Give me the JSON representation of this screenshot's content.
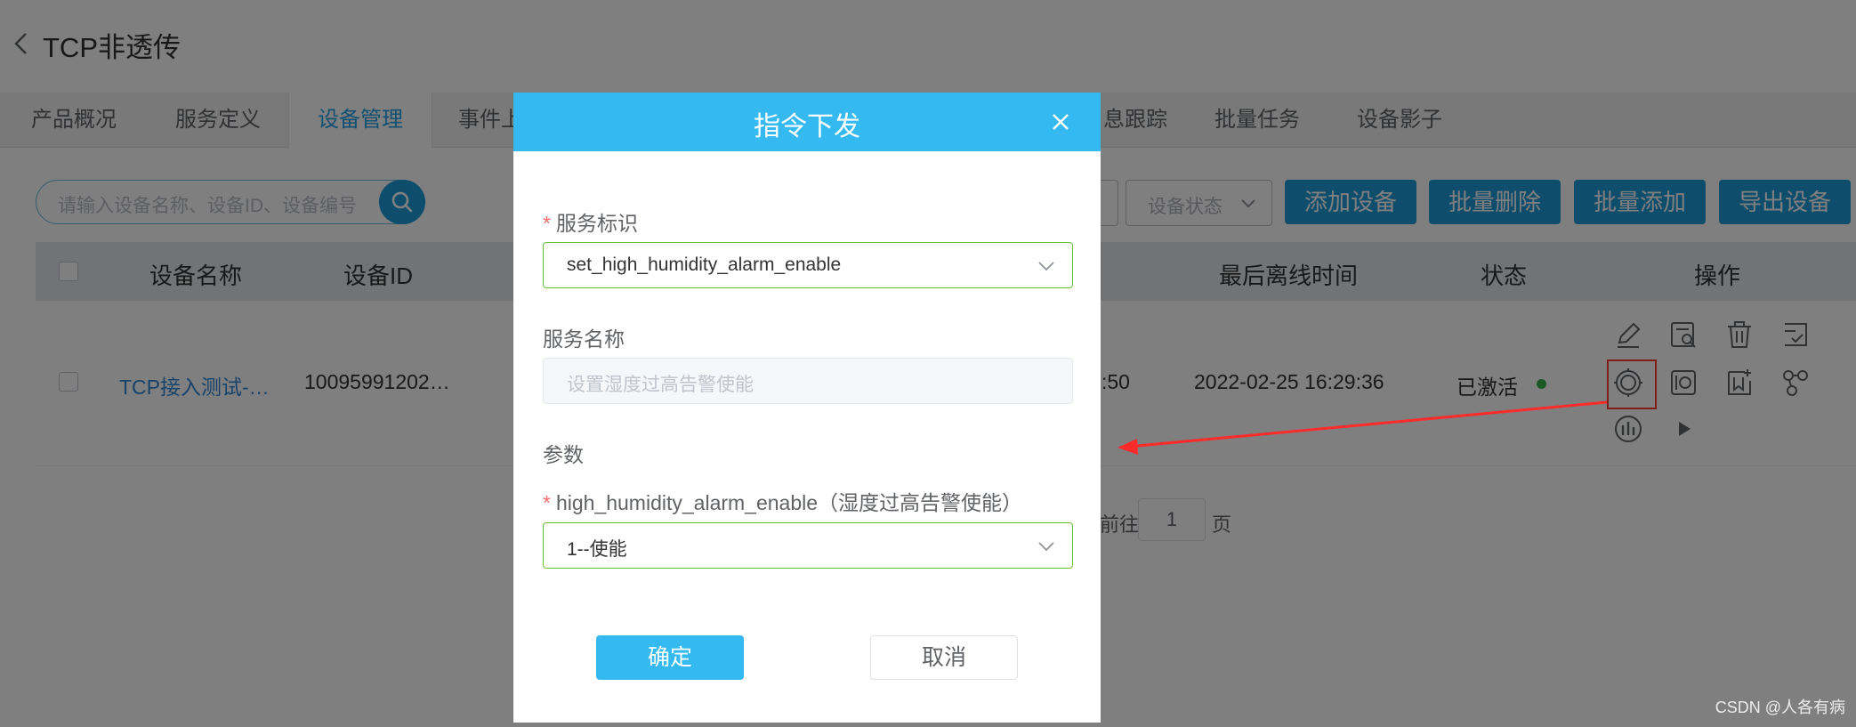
{
  "header": {
    "title": "TCP非透传"
  },
  "tabs": [
    {
      "label": "产品概况"
    },
    {
      "label": "服务定义"
    },
    {
      "label": "设备管理"
    },
    {
      "label": "事件上"
    },
    {
      "label": "息跟踪"
    },
    {
      "label": "批量任务"
    },
    {
      "label": "设备影子"
    }
  ],
  "toolbar": {
    "search_placeholder": "请输入设备名称、设备ID、设备编号",
    "status_placeholder": "设备状态",
    "add_device": "添加设备",
    "batch_delete": "批量删除",
    "batch_add": "批量添加",
    "export_devices": "导出设备"
  },
  "table": {
    "columns": [
      "设备名称",
      "设备ID",
      "最后离线时间",
      "状态",
      "操作"
    ],
    "rows": [
      {
        "device_name": "TCP接入测试-…",
        "device_id": "10095991202…",
        "partial_time": ":50",
        "last_offline": "2022-02-25 16:29:36",
        "status": "已激活"
      }
    ]
  },
  "pager": {
    "goto_label": "前往",
    "page_value": "1",
    "page_suffix": "页"
  },
  "dialog": {
    "title": "指令下发",
    "service_id_label": "服务标识",
    "service_id_value": "set_high_humidity_alarm_enable",
    "service_name_label": "服务名称",
    "service_name_placeholder": "设置湿度过高告警使能",
    "params_label": "参数",
    "param_label": "high_humidity_alarm_enable（湿度过高告警使能）",
    "param_value": "1--使能",
    "confirm": "确定",
    "cancel": "取消"
  },
  "watermark": "CSDN @人各有病",
  "colors": {
    "primary": "#1e9ad8",
    "dialog_header": "#34b9f0",
    "active_tab": "#20a0e6",
    "success": "#36b34a",
    "required": "#f56c6c",
    "highlight": "#ff3b30"
  }
}
